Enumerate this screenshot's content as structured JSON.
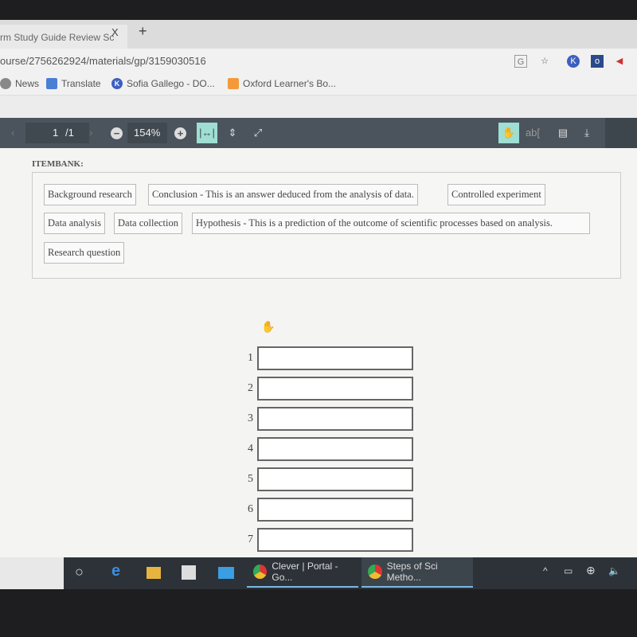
{
  "browser": {
    "tab_title": "rm Study Guide Review Sc",
    "tab_close": "X",
    "new_tab": "+",
    "url": "ourse/2756262924/materials/gp/3159030516",
    "bookmarks": [
      {
        "label": "News",
        "icon": "news-icon"
      },
      {
        "label": "Translate",
        "icon": "translate-icon"
      },
      {
        "label": "Sofia Gallego - DO...",
        "icon": "k-icon"
      },
      {
        "label": "Oxford Learner's Bo...",
        "icon": "oxford-icon"
      }
    ]
  },
  "pdf_toolbar": {
    "page": "1",
    "page_total": "/1",
    "zoom": "154%",
    "zoom_out": "−",
    "zoom_in": "+",
    "text_select": "ab["
  },
  "itembank": {
    "title": "ITEMBANK:",
    "items": [
      "Background research",
      "Conclusion - This is an answer deduced from the analysis of data.",
      "Controlled experiment",
      "Data analysis",
      "Data collection",
      "Hypothesis - This is a prediction of the outcome of scientific processes based on analysis.",
      "Research question"
    ]
  },
  "answers": {
    "numbers": [
      "1",
      "2",
      "3",
      "4",
      "5",
      "6",
      "7"
    ]
  },
  "taskbar": {
    "apps": [
      "Clever | Portal - Go...",
      "Steps of Sci Metho..."
    ]
  },
  "colors": {
    "toolbar": "#4b545c",
    "active_tool": "#9fded3",
    "taskbar": "#2c3238"
  }
}
